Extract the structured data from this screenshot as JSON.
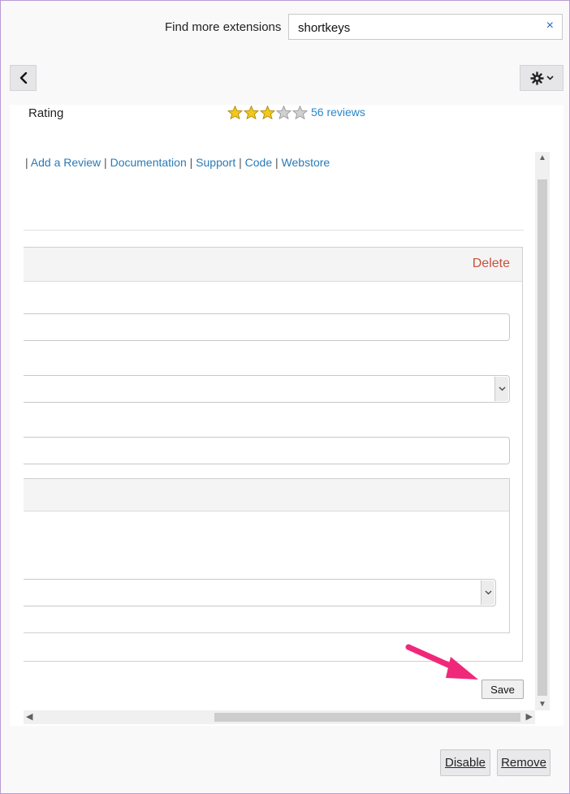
{
  "header": {
    "find_label": "Find more extensions",
    "search_value": "shortkeys",
    "clear_glyph": "×"
  },
  "toolbar": {
    "back_icon": "chevron-left-icon",
    "settings_icon": "gear-icon"
  },
  "details": {
    "rating_label": "Rating",
    "rating_stars": 3,
    "rating_max": 5,
    "reviews_link": "56 reviews",
    "links": [
      {
        "id": "add-review",
        "label": "Add a Review"
      },
      {
        "id": "documentation",
        "label": "Documentation"
      },
      {
        "id": "support",
        "label": "Support"
      },
      {
        "id": "code",
        "label": "Code"
      },
      {
        "id": "webstore",
        "label": "Webstore"
      }
    ],
    "link_separator": "|"
  },
  "shortcut_panel": {
    "delete_label": "Delete"
  },
  "actions": {
    "save_label": "Save",
    "disable_label": "Disable",
    "remove_label": "Remove"
  },
  "colors": {
    "link": "#2a7ab6",
    "delete": "#c9503f",
    "star_filled": "#f2c81e",
    "star_empty": "#d0d0d0",
    "annotation_arrow": "#f0287a"
  }
}
